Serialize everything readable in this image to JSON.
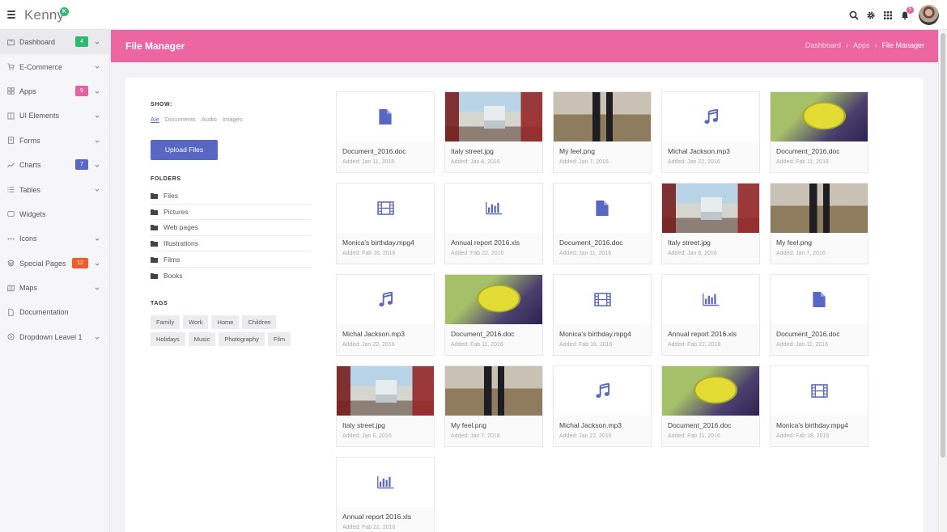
{
  "app": {
    "logo": "Kenny",
    "logo_badge": "K"
  },
  "topbar": {
    "notifications_count": "5"
  },
  "sidebar": {
    "items": [
      {
        "label": "Dashboard",
        "icon": "dashboard-icon",
        "badge": "4",
        "badge_color": "#2eb872",
        "chevron": true,
        "active": true
      },
      {
        "label": "E-Commerce",
        "icon": "cart-icon",
        "badge": "",
        "chevron": true
      },
      {
        "label": "Apps",
        "icon": "apps-icon",
        "badge": "9",
        "badge_color": "#e8609d",
        "chevron": true
      },
      {
        "label": "UI Elements",
        "icon": "ui-elements-icon",
        "badge": "",
        "chevron": true
      },
      {
        "label": "Forms",
        "icon": "forms-icon",
        "badge": "",
        "chevron": true
      },
      {
        "label": "Charts",
        "icon": "charts-icon",
        "badge": "7",
        "badge_color": "#5867c3",
        "chevron": true
      },
      {
        "label": "Tables",
        "icon": "tables-icon",
        "badge": "",
        "chevron": true
      },
      {
        "label": "Widgets",
        "icon": "widgets-icon",
        "badge": "",
        "chevron": false
      },
      {
        "label": "Icons",
        "icon": "icons-icon",
        "badge": "",
        "chevron": true
      },
      {
        "label": "Special Pages",
        "icon": "special-pages-icon",
        "badge": "12",
        "badge_color": "#f25a2a",
        "chevron": true
      },
      {
        "label": "Maps",
        "icon": "maps-icon",
        "badge": "",
        "chevron": true
      },
      {
        "label": "Documentation",
        "icon": "documentation-icon",
        "badge": "",
        "chevron": false
      },
      {
        "label": "Dropdown Leavel 1",
        "icon": "dropdown-icon",
        "badge": "",
        "chevron": true
      }
    ]
  },
  "header": {
    "title": "File Manager",
    "breadcrumb": [
      "Dashboard",
      "Apps",
      "File Manager"
    ],
    "bg_color": "#ec67a1"
  },
  "left_panel": {
    "show_label": "SHOW:",
    "filters": [
      "Ale",
      "Documents",
      "Audio",
      "Images"
    ],
    "active_filter": "Ale",
    "upload_label": "Upload Files",
    "folders_label": "FOLDERS",
    "folders": [
      "Files",
      "Pictures",
      "Web pages",
      "Illustrations",
      "Films",
      "Books"
    ],
    "tags_label": "TAGS",
    "tags": [
      "Family",
      "Work",
      "Home",
      "Children",
      "Holidays",
      "Music",
      "Photography",
      "Film"
    ]
  },
  "files": [
    {
      "name": "Document_2016.doc",
      "date": "Added: Jan 11, 2016",
      "kind": "doc"
    },
    {
      "name": "Italy street.jpg",
      "date": "Added: Jan 6, 2016",
      "kind": "street"
    },
    {
      "name": "My feel.png",
      "date": "Added: Jan 7, 2016",
      "kind": "feel"
    },
    {
      "name": "Michal Jackson.mp3",
      "date": "Added: Jan 22, 2016",
      "kind": "audio"
    },
    {
      "name": "Document_2016.doc",
      "date": "Added: Fab 11, 2016",
      "kind": "leaf"
    },
    {
      "name": "Monica's birthday.mpg4",
      "date": "Added: Fab 18, 2016",
      "kind": "video"
    },
    {
      "name": "Annual report 2016.xls",
      "date": "Added: Fab 22, 2016",
      "kind": "chart"
    },
    {
      "name": "Document_2016.doc",
      "date": "Added: Jan 11, 2016",
      "kind": "doc"
    },
    {
      "name": "Italy street.jpg",
      "date": "Added: Jan 6, 2016",
      "kind": "street"
    },
    {
      "name": "My feel.png",
      "date": "Added: Jan 7, 2016",
      "kind": "feel"
    },
    {
      "name": "Michal Jackson.mp3",
      "date": "Added: Jan 22, 2016",
      "kind": "audio"
    },
    {
      "name": "Document_2016.doc",
      "date": "Added: Fab 11, 2016",
      "kind": "leaf"
    },
    {
      "name": "Monica's birthday.mpg4",
      "date": "Added: Fab 18, 2016",
      "kind": "video"
    },
    {
      "name": "Annual report 2016.xls",
      "date": "Added: Fab 22, 2016",
      "kind": "chart"
    },
    {
      "name": "Document_2016.doc",
      "date": "Added: Jan 11, 2016",
      "kind": "doc"
    },
    {
      "name": "Italy street.jpg",
      "date": "Added: Jan 6, 2016",
      "kind": "street"
    },
    {
      "name": "My feel.png",
      "date": "Added: Jan 7, 2016",
      "kind": "feel"
    },
    {
      "name": "Michal Jackson.mp3",
      "date": "Added: Jan 22, 2016",
      "kind": "audio"
    },
    {
      "name": "Document_2016.doc",
      "date": "Added: Fab 11, 2016",
      "kind": "leaf"
    },
    {
      "name": "Monica's birthday.mpg4",
      "date": "Added: Fab 18, 2016",
      "kind": "video"
    },
    {
      "name": "Annual report 2016.xls",
      "date": "Added: Fab 22, 2016",
      "kind": "chart"
    }
  ],
  "colors": {
    "accent": "#5867c3",
    "pink": "#ec67a1",
    "green": "#2eb872",
    "orange": "#f25a2a"
  }
}
